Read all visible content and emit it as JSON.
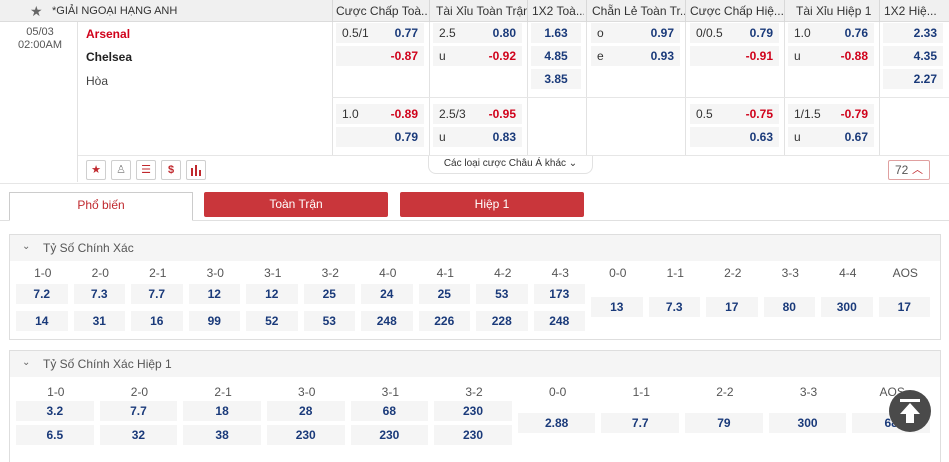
{
  "header": {
    "league": "*GIẢI NGOẠI HẠNG ANH",
    "columns": [
      "Cược Chấp Toà...",
      "Tài Xỉu Toàn Trận",
      "1X2 Toà...",
      "Chẵn Lẻ Toàn Tr...",
      "Cược Chấp Hiệ...",
      "Tài Xỉu Hiệp 1",
      "1X2 Hiệ..."
    ]
  },
  "match": {
    "date": "05/03",
    "time": "02:00AM",
    "home": "Arsenal",
    "away": "Chelsea",
    "draw": "Hòa"
  },
  "odds": {
    "ah1_line": "0.5/1",
    "ah1_home": "0.77",
    "ah1_away": "-0.87",
    "ou1_line": "2.5",
    "ou1_over": "0.80",
    "ou1_u": "u",
    "ou1_under": "-0.92",
    "x12_home": "1.63",
    "x12_away": "4.85",
    "x12_draw": "3.85",
    "oe_o": "o",
    "oe_odd": "0.97",
    "oe_e": "e",
    "oe_even": "0.93",
    "h1ah_line": "0/0.5",
    "h1ah_home": "0.79",
    "h1ah_away": "-0.91",
    "h1ou_line": "1.0",
    "h1ou_over": "0.76",
    "h1ou_u": "u",
    "h1ou_under": "-0.88",
    "h1x_home": "2.33",
    "h1x_away": "4.35",
    "h1x_draw": "2.27",
    "ah2_line": "1.0",
    "ah2_home": "-0.89",
    "ah2_away": "0.79",
    "ou2_line": "2.5/3",
    "ou2_over": "-0.95",
    "ou2_u": "u",
    "ou2_under": "0.83",
    "h1ah2_line": "0.5",
    "h1ah2_home": "-0.75",
    "h1ah2_away": "0.63",
    "h1ou2_line": "1/1.5",
    "h1ou2_over": "-0.79",
    "h1ou2_u": "u",
    "h1ou2_under": "0.67"
  },
  "toolbar": {
    "more_label": "Các loại cược Châu Á khác",
    "count": "72"
  },
  "tabs": [
    "Phổ biến",
    "Toàn Trận",
    "Hiệp 1"
  ],
  "correct_score": {
    "title": "Tỷ Số Chính Xác",
    "cols": [
      {
        "label": "1-0",
        "top": "7.2",
        "bottom": "14"
      },
      {
        "label": "2-0",
        "top": "7.3",
        "bottom": "31"
      },
      {
        "label": "2-1",
        "top": "7.7",
        "bottom": "16"
      },
      {
        "label": "3-0",
        "top": "12",
        "bottom": "99"
      },
      {
        "label": "3-1",
        "top": "12",
        "bottom": "52"
      },
      {
        "label": "3-2",
        "top": "25",
        "bottom": "53"
      },
      {
        "label": "4-0",
        "top": "24",
        "bottom": "248"
      },
      {
        "label": "4-1",
        "top": "25",
        "bottom": "226"
      },
      {
        "label": "4-2",
        "top": "53",
        "bottom": "228"
      },
      {
        "label": "4-3",
        "top": "173",
        "bottom": "248"
      }
    ],
    "draws": [
      {
        "label": "0-0",
        "value": "13"
      },
      {
        "label": "1-1",
        "value": "7.3"
      },
      {
        "label": "2-2",
        "value": "17"
      },
      {
        "label": "3-3",
        "value": "80"
      },
      {
        "label": "4-4",
        "value": "300"
      },
      {
        "label": "AOS",
        "value": "17"
      }
    ]
  },
  "correct_score_h1": {
    "title": "Tỷ Số Chính Xác Hiệp 1",
    "cols": [
      {
        "label": "1-0",
        "top": "3.2",
        "bottom": "6.5"
      },
      {
        "label": "2-0",
        "top": "7.7",
        "bottom": "32"
      },
      {
        "label": "2-1",
        "top": "18",
        "bottom": "38"
      },
      {
        "label": "3-0",
        "top": "28",
        "bottom": "230"
      },
      {
        "label": "3-1",
        "top": "68",
        "bottom": "230"
      },
      {
        "label": "3-2",
        "top": "230",
        "bottom": "230"
      }
    ],
    "draws": [
      {
        "label": "0-0",
        "value": "2.88"
      },
      {
        "label": "1-1",
        "value": "7.7"
      },
      {
        "label": "2-2",
        "value": "79"
      },
      {
        "label": "3-3",
        "value": "300"
      },
      {
        "label": "AOS",
        "value": "68"
      }
    ]
  },
  "colors": {
    "accent_red": "#c9363b",
    "odds_blue": "#1a3a7a",
    "negative_red": "#d0021b"
  }
}
